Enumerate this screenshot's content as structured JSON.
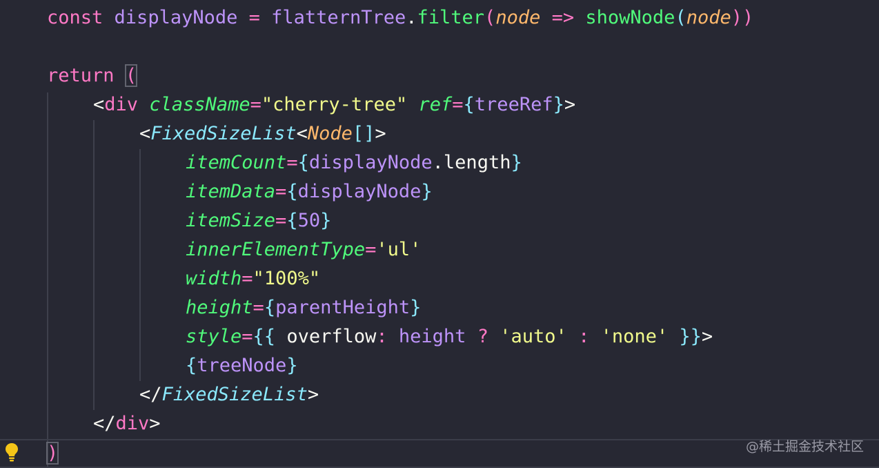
{
  "editor": {
    "line_const": {
      "kw": "const",
      "name": "displayNode",
      "eq": "=",
      "obj": "flatternTree",
      "dot": ".",
      "method": "filter",
      "open": "(",
      "param": "node",
      "arrow": "=>",
      "fn": "showNode",
      "open2": "(",
      "param2": "node",
      "close": "))"
    },
    "line_return": {
      "kw": "return",
      "paren": "("
    },
    "line_div": {
      "lt": "<",
      "tag": "div",
      "attr1": "className",
      "eq1": "=",
      "val1": "\"cherry-tree\"",
      "attr2": "ref",
      "eq2": "=",
      "ob": "{",
      "ref": "treeRef",
      "cb": "}",
      "gt": ">"
    },
    "line_list": {
      "lt": "<",
      "comp": "FixedSizeList",
      "lt2": "<",
      "type": "Node",
      "arr": "[]",
      "gt": ">"
    },
    "props": {
      "item_count": {
        "attr": "itemCount",
        "eq": "=",
        "ob": "{",
        "var": "displayNode",
        "dot": ".",
        "prop": "length",
        "cb": "}"
      },
      "item_data": {
        "attr": "itemData",
        "eq": "=",
        "ob": "{",
        "var": "displayNode",
        "cb": "}"
      },
      "item_size": {
        "attr": "itemSize",
        "eq": "=",
        "ob": "{",
        "num": "50",
        "cb": "}"
      },
      "inner_type": {
        "attr": "innerElementType",
        "eq": "=",
        "str": "'ul'"
      },
      "width": {
        "attr": "width",
        "eq": "=",
        "str": "\"100%\""
      },
      "height": {
        "attr": "height",
        "eq": "=",
        "ob": "{",
        "var": "parentHeight",
        "cb": "}"
      },
      "style": {
        "attr": "style",
        "eq": "=",
        "ob": "{{",
        "key": "overflow",
        "colon": ":",
        "var": "height",
        "q": "?",
        "s1": "'auto'",
        "colon2": ":",
        "s2": "'none'",
        "cb": "}}",
        "gt": ">"
      }
    },
    "line_child": {
      "ob": "{",
      "var": "treeNode",
      "cb": "}"
    },
    "line_list_close": {
      "lt": "</",
      "comp": "FixedSizeList",
      "gt": ">"
    },
    "line_div_close": {
      "lt": "</",
      "tag": "div",
      "gt": ">"
    },
    "line_return_close": {
      "paren": ")"
    }
  },
  "watermark": "@稀土掘金技术社区",
  "icons": {
    "hint": "lightbulb-icon"
  }
}
